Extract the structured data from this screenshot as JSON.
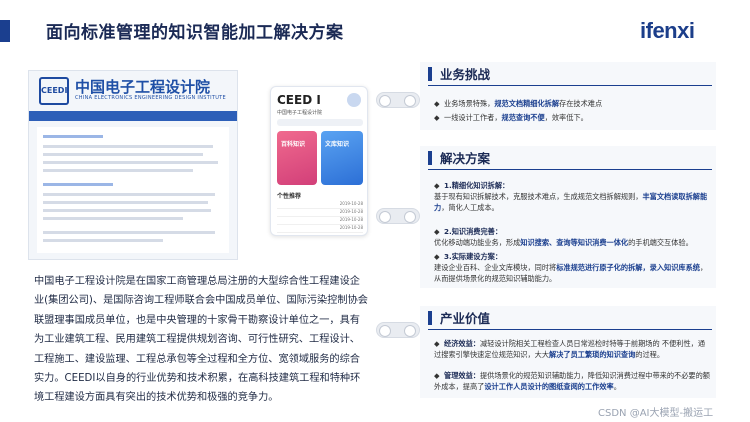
{
  "header": {
    "title": "面向标准管理的知识智能加工解决方案",
    "logo": "ifenxi"
  },
  "left": {
    "institute_cn": "中国电子工程设计院",
    "institute_en": "CHINA ELECTRONICS ENGINEERING DESIGN INSTITUTE",
    "emblem": "CEEDI",
    "phone_app": {
      "title": "CEED I",
      "subtitle": "中国电子工程设计院",
      "card1": "百科知识",
      "card2": "文库知识",
      "list_title": "个性推荐",
      "rows": [
        "2019-10-28",
        "2019-10-28",
        "2019-10-28",
        "2019-10-28"
      ]
    },
    "intro": "中国电子工程设计院是在国家工商管理总局注册的大型综合性工程建设企业(集团公司)、是国际咨询工程师联合会中国成员单位、国际污染控制协会联盟理事国成员单位，也是中央管理的十家骨干勘察设计单位之一，具有为工业建筑工程、民用建筑工程提供规划咨询、可行性研究、工程设计、工程施工、建设监理、工程总承包等全过程和全方位、宽领域服务的综合实力。CEEDI以自身的行业优势和技术积累，在高科技建筑工程和特种环境工程建设方面具有突出的技术优势和极强的竞争力。"
  },
  "panels": {
    "challenge": {
      "title": "业务挑战",
      "items": [
        {
          "pre": "业务场景特殊，",
          "hl": "规范文档精细化拆解",
          "post": "存在技术难点"
        },
        {
          "pre": "一线设计工作者，",
          "hl": "规范查询不便",
          "post": "，效率低下。"
        }
      ]
    },
    "solution": {
      "title": "解决方案",
      "s1_head": "1.精细化知识拆解：",
      "s1_pre": "基于现有知识拆解技术，克服技术难点，生成规范文档拆解规则，",
      "s1_hl": "丰富文档读取拆解能力",
      "s1_post": "，简化人工成本。",
      "s2_head": "2.知识消费完善：",
      "s2_pre": "优化移动端功能业务，形成",
      "s2_hl": "知识搜索、查询等知识消费一体化",
      "s2_post": "的手机端交互体验。",
      "s3_head": "3.实际建设方案：",
      "s3_pre": "建设企业百科、企业文库模块，同时将",
      "s3_hl": "标准规范进行原子化的拆解，录入知识库系统",
      "s3_post": "，从而提供场景化的规范知识辅助能力。"
    },
    "value": {
      "title": "产业价值",
      "v1_head": "经济效益：",
      "v1_pre": "减轻设计院相关工程检查人员日常巡检时特等于前期场的 不便利性，通过搜索引擎快速定位规范知识，大大",
      "v1_hl": "解决了员工繁琐的知识查询",
      "v1_post": "的过程。",
      "v2_head": "管理效益：",
      "v2_pre": "提供场景化的规范知识辅助能力，降低知识消费过程中带来的不必要的额外成本，提高了",
      "v2_hl": "设计工作人员设计的图纸查阅的工作效率",
      "v2_post": "。"
    }
  },
  "watermark": "CSDN @AI大模型-搬运工",
  "colors": {
    "primary": "#1b3f8f",
    "panel_bg": "#f6f8fb"
  }
}
